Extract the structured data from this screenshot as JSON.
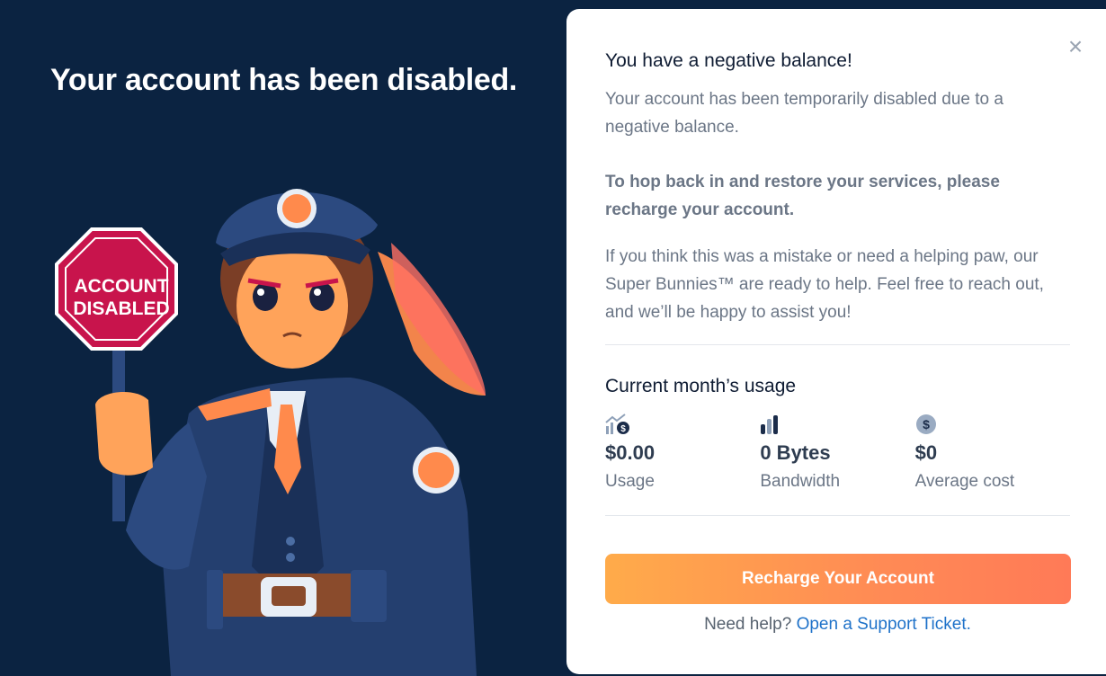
{
  "page": {
    "headline": "Your account has been disabled.",
    "sign_text_line1": "ACCOUNT",
    "sign_text_line2": "DISABLED"
  },
  "modal": {
    "close_icon": "close-icon",
    "title": "You have a negative balance!",
    "paragraph1": "Your account has been temporarily disabled due to a negative balance.",
    "paragraph2": "To hop back in and restore your services, please recharge your account.",
    "paragraph3": "If you think this was a mistake or need a helping paw, our Super Bunnies™ are ready to help. Feel free to reach out, and we’ll be happy to assist you!",
    "usage_title": "Current month’s usage",
    "stats": [
      {
        "icon": "usage-trend-icon",
        "value": "$0.00",
        "label": "Usage"
      },
      {
        "icon": "bandwidth-bars-icon",
        "value": "0 Bytes",
        "label": "Bandwidth"
      },
      {
        "icon": "dollar-coin-icon",
        "value": "$0",
        "label": "Average cost"
      }
    ],
    "cta_label": "Recharge Your Account",
    "help_text": "Need help?",
    "help_link": "Open a Support Ticket."
  },
  "colors": {
    "background": "#0b2341",
    "accent_orange": "#ff8a55",
    "link_blue": "#1f72c9",
    "stop_sign_red": "#c8144c"
  }
}
